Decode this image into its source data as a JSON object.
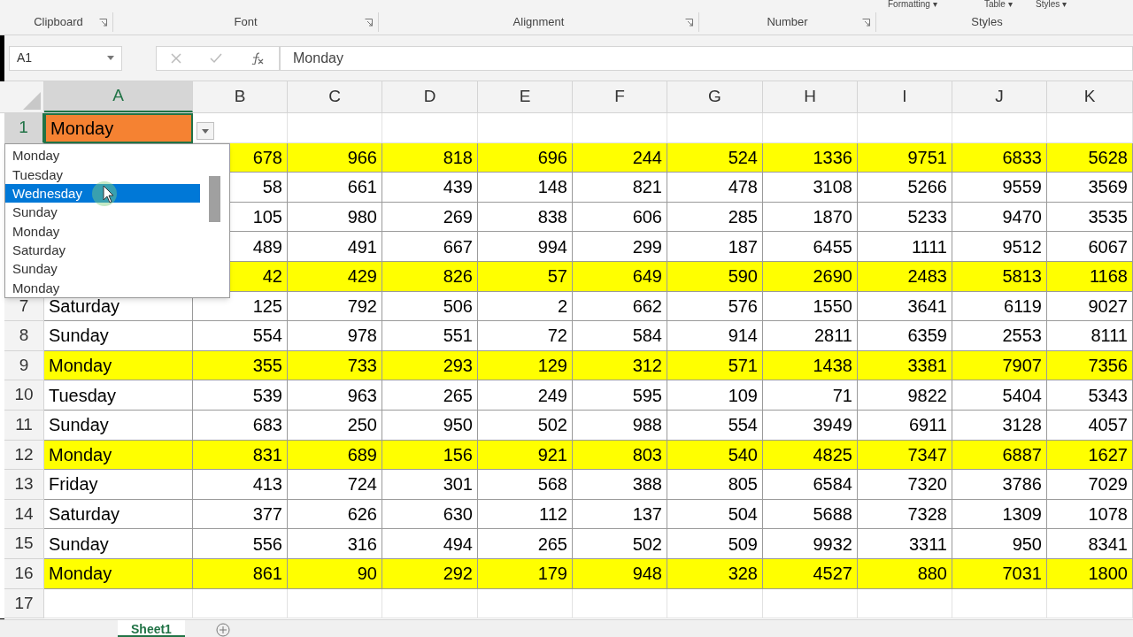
{
  "ribbon": {
    "partial_buttons": [
      "Formatting ▾",
      "Table ▾",
      "Styles ▾"
    ],
    "groups": [
      {
        "label": "Clipboard",
        "launcher": true
      },
      {
        "label": "Font",
        "launcher": true
      },
      {
        "label": "Alignment",
        "launcher": true
      },
      {
        "label": "Number",
        "launcher": true
      },
      {
        "label": "Styles",
        "launcher": false
      }
    ]
  },
  "formula_bar": {
    "name_box": "A1",
    "value": "Monday"
  },
  "columns": [
    "A",
    "B",
    "C",
    "D",
    "E",
    "F",
    "G",
    "H",
    "I",
    "J",
    "K"
  ],
  "rows": [
    {
      "number": "1",
      "day": "Monday",
      "selected": true,
      "color": "#f58232",
      "values": []
    },
    {
      "color": "#ffff00",
      "values": [
        "678",
        "966",
        "818",
        "696",
        "244",
        "524",
        "1336",
        "9751",
        "6833",
        "5628"
      ]
    },
    {
      "color": "#ffffff",
      "values": [
        "58",
        "661",
        "439",
        "148",
        "821",
        "478",
        "3108",
        "5266",
        "9559",
        "3569"
      ]
    },
    {
      "color": "#ffffff",
      "values": [
        "105",
        "980",
        "269",
        "838",
        "606",
        "285",
        "1870",
        "5233",
        "9470",
        "3535"
      ]
    },
    {
      "color": "#ffffff",
      "values": [
        "489",
        "491",
        "667",
        "994",
        "299",
        "187",
        "6455",
        "1111",
        "9512",
        "6067"
      ]
    },
    {
      "color": "#ffff00",
      "values": [
        "42",
        "429",
        "826",
        "57",
        "649",
        "590",
        "2690",
        "2483",
        "5813",
        "1168"
      ]
    },
    {
      "number": "7",
      "day": "Saturday",
      "selected": false,
      "color": "#ffffff",
      "values": [
        "125",
        "792",
        "506",
        "2",
        "662",
        "576",
        "1550",
        "3641",
        "6119",
        "9027"
      ]
    },
    {
      "number": "8",
      "day": "Sunday",
      "selected": false,
      "color": "#ffffff",
      "values": [
        "554",
        "978",
        "551",
        "72",
        "584",
        "914",
        "2811",
        "6359",
        "2553",
        "8111"
      ]
    },
    {
      "number": "9",
      "day": "Monday",
      "selected": false,
      "color": "#ffff00",
      "values": [
        "355",
        "733",
        "293",
        "129",
        "312",
        "571",
        "1438",
        "3381",
        "7907",
        "7356"
      ]
    },
    {
      "number": "10",
      "day": "Tuesday",
      "selected": false,
      "color": "#ffffff",
      "values": [
        "539",
        "963",
        "265",
        "249",
        "595",
        "109",
        "71",
        "9822",
        "5404",
        "5343"
      ]
    },
    {
      "number": "11",
      "day": "Sunday",
      "selected": false,
      "color": "#ffffff",
      "values": [
        "683",
        "250",
        "950",
        "502",
        "988",
        "554",
        "3949",
        "6911",
        "3128",
        "4057"
      ]
    },
    {
      "number": "12",
      "day": "Monday",
      "selected": false,
      "color": "#ffff00",
      "values": [
        "831",
        "689",
        "156",
        "921",
        "803",
        "540",
        "4825",
        "7347",
        "6887",
        "1627"
      ]
    },
    {
      "number": "13",
      "day": "Friday",
      "selected": false,
      "color": "#ffffff",
      "values": [
        "413",
        "724",
        "301",
        "568",
        "388",
        "805",
        "6584",
        "7320",
        "3786",
        "7029"
      ]
    },
    {
      "number": "14",
      "day": "Saturday",
      "selected": false,
      "color": "#ffffff",
      "values": [
        "377",
        "626",
        "630",
        "112",
        "137",
        "504",
        "5688",
        "7328",
        "1309",
        "1078"
      ]
    },
    {
      "number": "15",
      "day": "Sunday",
      "selected": false,
      "color": "#ffffff",
      "values": [
        "556",
        "316",
        "494",
        "265",
        "502",
        "509",
        "9932",
        "3311",
        "950",
        "8341"
      ]
    },
    {
      "number": "16",
      "day": "Monday",
      "selected": false,
      "color": "#ffff00",
      "values": [
        "861",
        "90",
        "292",
        "179",
        "948",
        "328",
        "4527",
        "880",
        "7031",
        "1800"
      ]
    },
    {
      "number": "17",
      "selected": false,
      "values": []
    }
  ],
  "dropdown": {
    "items": [
      {
        "label": "Monday",
        "selected": false
      },
      {
        "label": "Tuesday",
        "selected": false
      },
      {
        "label": "Wednesday",
        "selected": true
      },
      {
        "label": "Sunday",
        "selected": false
      },
      {
        "label": "Monday",
        "selected": false
      },
      {
        "label": "Saturday",
        "selected": false
      },
      {
        "label": "Sunday",
        "selected": false
      },
      {
        "label": "Monday",
        "selected": false
      }
    ]
  },
  "sheet_tabs": [
    {
      "label": "Sheet1",
      "selected": true
    }
  ]
}
